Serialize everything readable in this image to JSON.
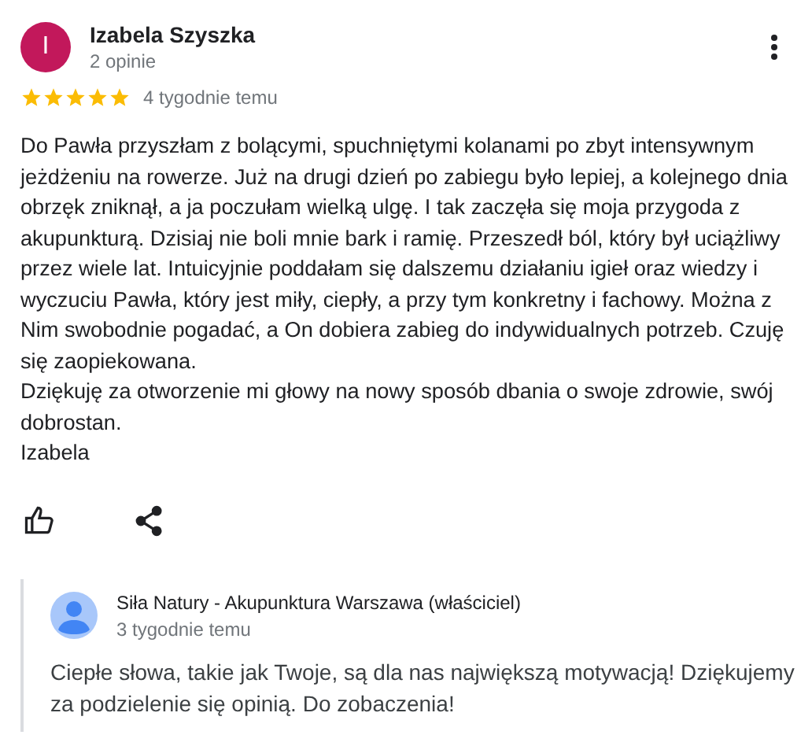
{
  "review": {
    "author": "Izabela Szyszka",
    "initial": "I",
    "count": "2 opinie",
    "stars": 5,
    "time": "4 tygodnie temu",
    "paragraphs": [
      "Do Pawła przyszłam z bolącymi, spuchniętymi kolanami po zbyt intensywnym jeżdżeniu na rowerze. Już na drugi dzień po zabiegu było lepiej, a kolejnego dnia obrzęk zniknął, a ja poczułam wielką ulgę. I tak zaczęła się moja przygoda z akupunkturą. Dzisiaj nie boli mnie bark i ramię. Przeszedł ból, który był uciążliwy przez wiele lat. Intuicyjnie poddałam się dalszemu działaniu igieł oraz wiedzy i wyczuciu Pawła, który jest miły, ciepły, a przy tym konkretny i fachowy. Można z Nim swobodnie pogadać, a On dobiera zabieg do indywidualnych potrzeb. Czuję się zaopiekowana.",
      "Dziękuję za otworzenie mi głowy na nowy sposób dbania o swoje zdrowie, swój dobrostan.",
      "Izabela"
    ]
  },
  "reply": {
    "author": "Siła Natury - Akupunktura Warszawa (właściciel)",
    "time": "3 tygodnie temu",
    "text": "Ciepłe słowa, takie jak Twoje, są dla nas największą motywacją! Dziękujemy za podzielenie się opinią. Do zobaczenia!"
  }
}
